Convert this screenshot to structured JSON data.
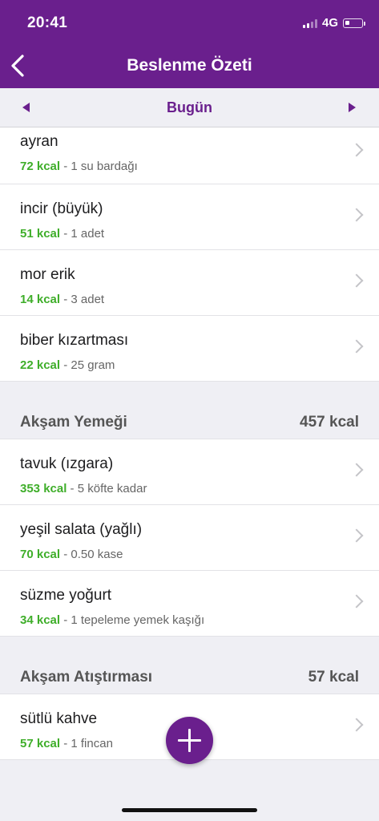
{
  "status_bar": {
    "time": "20:41",
    "network": "4G",
    "icons": [
      "signal-icon",
      "battery-icon"
    ]
  },
  "nav": {
    "title": "Beslenme Özeti",
    "back_icon": "chevron-left-icon"
  },
  "date_bar": {
    "label": "Bugün",
    "prev_icon": "triangle-left-icon",
    "next_icon": "triangle-right-icon"
  },
  "snack_items": [
    {
      "name": "ayran",
      "kcal": "72 kcal",
      "portion": " - 1 su bardağı"
    },
    {
      "name": "incir (büyük)",
      "kcal": "51 kcal",
      "portion": " - 1 adet"
    },
    {
      "name": "mor erik",
      "kcal": "14 kcal",
      "portion": " - 3 adet"
    },
    {
      "name": "biber kızartması",
      "kcal": "22 kcal",
      "portion": " - 25 gram"
    }
  ],
  "dinner": {
    "title": "Akşam Yemeği",
    "total": "457 kcal",
    "items": [
      {
        "name": "tavuk (ızgara)",
        "kcal": "353 kcal",
        "portion": " - 5 köfte kadar"
      },
      {
        "name": "yeşil salata (yağlı)",
        "kcal": "70 kcal",
        "portion": " - 0.50 kase"
      },
      {
        "name": "süzme yoğurt",
        "kcal": "34 kcal",
        "portion": " - 1 tepeleme yemek kaşığı"
      }
    ]
  },
  "evening_snack": {
    "title": "Akşam Atıştırması",
    "total": "57 kcal",
    "items": [
      {
        "name": "sütlü kahve",
        "kcal": "57 kcal",
        "portion": " - 1 fincan"
      }
    ]
  },
  "colors": {
    "brand_purple": "#6a1f8d",
    "kcal_green": "#3fae2a",
    "background": "#efeff4"
  },
  "fab_icon": "plus-icon"
}
